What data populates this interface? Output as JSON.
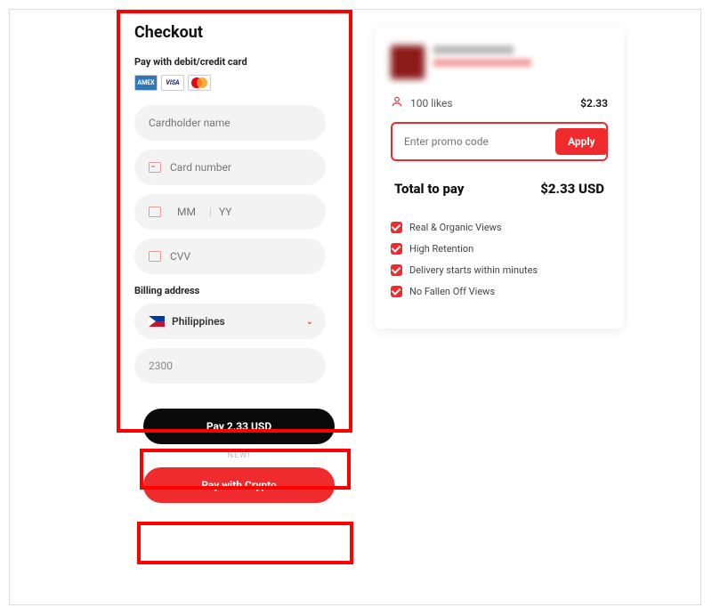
{
  "checkout": {
    "title": "Checkout",
    "pay_label": "Pay with debit/credit card",
    "logos": {
      "amex": "AMEX",
      "visa": "VISA"
    },
    "placeholders": {
      "cardholder": "Cardholder name",
      "cardnumber": "Card number",
      "mm": "MM",
      "yy": "YY",
      "cvv": "CVV"
    },
    "billing_label": "Billing address",
    "country": "Philippines",
    "postal": "2300"
  },
  "buttons": {
    "pay": "Pay 2.33 USD",
    "new_tag": "NEW!",
    "crypto": "Pay with Crypto"
  },
  "summary": {
    "likes": "100 likes",
    "likes_price": "$2.33",
    "promo_placeholder": "Enter promo code",
    "apply": "Apply",
    "total_label": "Total to pay",
    "total_value": "$2.33 USD",
    "features": [
      "Real & Organic Views",
      "High Retention",
      "Delivery starts within minutes",
      "No Fallen Off Views"
    ]
  }
}
